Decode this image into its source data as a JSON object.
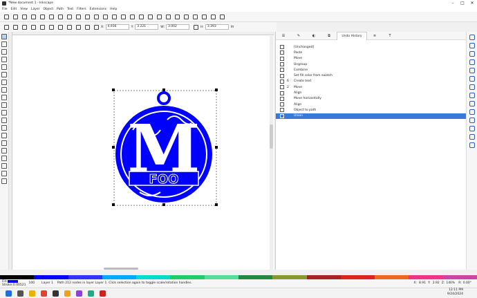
{
  "window": {
    "title": "*New document 1 - Inkscape",
    "controls": [
      "–",
      "□",
      "✕"
    ]
  },
  "menu": [
    "File",
    "Edit",
    "View",
    "Layer",
    "Object",
    "Path",
    "Text",
    "Filters",
    "Extensions",
    "Help"
  ],
  "toolbar": {
    "x_label": "X:",
    "x_value": "4.936",
    "y_label": "Y:",
    "y_value": "3.221",
    "w_label": "W:",
    "w_value": "3.002",
    "h_label": "H:",
    "h_value": "3.393",
    "unit": "in"
  },
  "drawing": {
    "text": "FOO",
    "monogram": "M",
    "color": "#0000ff"
  },
  "panel": {
    "active_tab": "Undo History",
    "history": [
      {
        "label": "[Unchanged]",
        "count": "",
        "icon": "document-icon"
      },
      {
        "label": "Paste",
        "count": "",
        "icon": "paste-icon"
      },
      {
        "label": "Move",
        "count": "",
        "icon": "move-icon"
      },
      {
        "label": "Ungroup",
        "count": "",
        "icon": "ungroup-icon"
      },
      {
        "label": "Combine",
        "count": "",
        "icon": "combine-icon"
      },
      {
        "label": "Set fill color from swatch",
        "count": "",
        "icon": "fill-icon"
      },
      {
        "label": "Create text",
        "count": "6",
        "icon": "text-icon"
      },
      {
        "label": "Move",
        "count": "2",
        "icon": "move-icon"
      },
      {
        "label": "Align",
        "count": "",
        "icon": "align-icon"
      },
      {
        "label": "Move horizontally",
        "count": "",
        "icon": "move-icon"
      },
      {
        "label": "Align",
        "count": "",
        "icon": "align-icon"
      },
      {
        "label": "Object to path",
        "count": "",
        "icon": "path-icon"
      },
      {
        "label": "Union",
        "count": "",
        "icon": "union-icon"
      }
    ],
    "selected_index": 12
  },
  "status": {
    "fill_label": "Fill:",
    "stroke_label": "Stroke:",
    "stroke_width": "0.00521",
    "opacity": "100",
    "layer": "Layer 1",
    "message": "Path 212 nodes in layer Layer 1. Click selection again to toggle scale/rotation handles.",
    "cursor_x_label": "X:",
    "cursor_x": "8.91",
    "cursor_y_label": "Y:",
    "cursor_y": "2.92",
    "zoom_label": "Z:",
    "zoom": "140%",
    "rotate_label": "R:",
    "rotate": "0.00°"
  },
  "taskbar": {
    "time": "12:11 PM",
    "date": "9/24/2024"
  },
  "colors": {
    "accent": "#3b79d9",
    "fill": "#0000ff"
  }
}
